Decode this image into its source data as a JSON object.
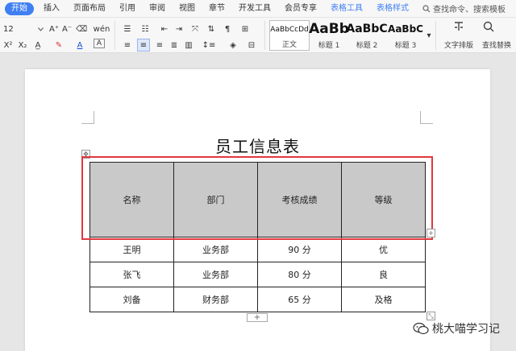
{
  "menubar": {
    "tabs": [
      "开始",
      "插入",
      "页面布局",
      "引用",
      "审阅",
      "视图",
      "章节",
      "开发工具",
      "会员专享"
    ],
    "context_tabs": [
      "表格工具",
      "表格样式"
    ],
    "search_label": "查找命令、搜索模板"
  },
  "ribbon": {
    "font_size": "12",
    "styles": [
      {
        "sample": "AaBbCcDd",
        "name": "正文"
      },
      {
        "sample": "AaBb",
        "name": "标题 1"
      },
      {
        "sample": "AaBbC",
        "name": "标题 2"
      },
      {
        "sample": "AaBbC",
        "name": "标题 3"
      }
    ],
    "text_layout_label": "文字排版",
    "find_replace_label": "查找替换"
  },
  "document": {
    "title": "员工信息表",
    "table": {
      "headers": [
        "名称",
        "部门",
        "考核成绩",
        "等级"
      ],
      "rows": [
        [
          "王明",
          "业务部",
          "90 分",
          "优"
        ],
        [
          "张飞",
          "业务部",
          "80 分",
          "良"
        ],
        [
          "刘备",
          "财务部",
          "65 分",
          "及格"
        ]
      ]
    }
  },
  "watermark": {
    "text": "桃大喵学习记"
  },
  "colors": {
    "accent": "#3f7ff2",
    "highlight": "#e0383e",
    "header_fill": "#c9c9c9"
  }
}
